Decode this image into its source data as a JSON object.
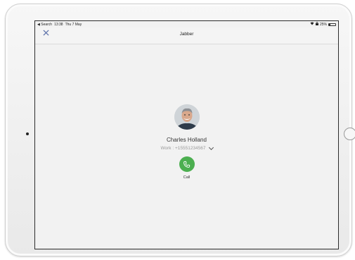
{
  "status_bar": {
    "back_label": "◀ Search",
    "time": "13:38",
    "date": "Thu 7 May",
    "battery_text": "25%",
    "battery_level": 0.25
  },
  "nav": {
    "title": "Jabber",
    "close_icon": "close-icon"
  },
  "contact": {
    "name": "Charles Holland",
    "number": "Work : +15551234567"
  },
  "actions": {
    "call_label": "Call"
  },
  "colors": {
    "accent": "#5a6fa8",
    "call_green": "#4caf50"
  }
}
